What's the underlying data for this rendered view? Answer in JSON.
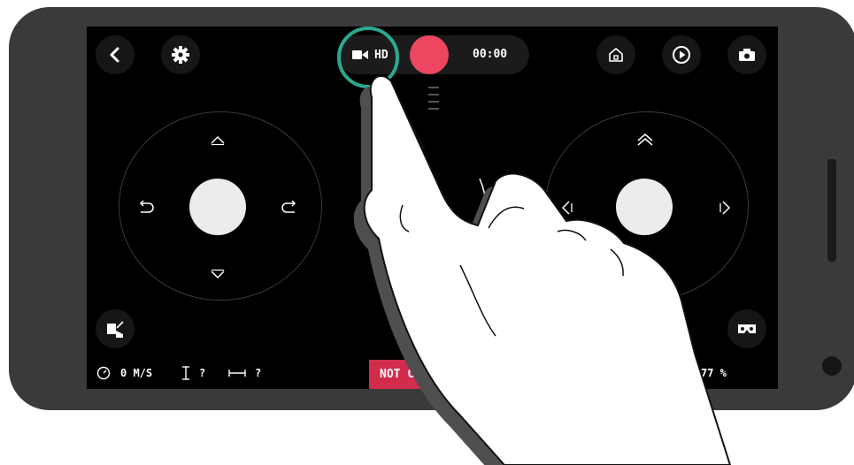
{
  "record": {
    "quality": "HD",
    "timer": "00:00"
  },
  "status": {
    "speed": "0 M/S",
    "altitude": "?",
    "distance": "?",
    "connection": "NOT CO",
    "battery": "77 %"
  },
  "icons": {
    "back": "chevron-left-icon",
    "settings": "gear-icon",
    "camera": "video-camera-icon",
    "record": "record-button",
    "home": "home-icon",
    "play": "play-icon",
    "photo": "camera-icon",
    "gallery": "photo-flip-icon",
    "vr": "vr-headset-icon",
    "speed": "speedometer-icon",
    "altitude": "altitude-icon",
    "distance": "distance-icon",
    "drone": "drone-icon"
  },
  "colors": {
    "accent": "#2aa98f",
    "record": "#ec4660",
    "alert": "#d22c4d"
  }
}
